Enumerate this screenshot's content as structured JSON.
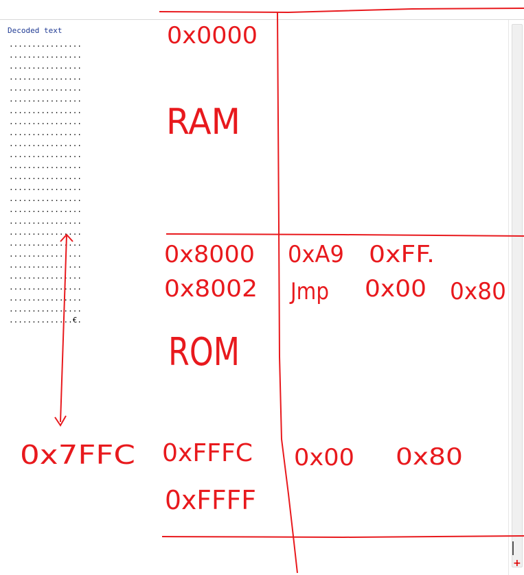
{
  "panel": {
    "title": "Decoded text",
    "lines": [
      "................",
      "................",
      "................",
      "................",
      "................",
      "................",
      "................",
      "................",
      "................",
      "................",
      "................",
      "................",
      "................",
      "................",
      "................",
      "................",
      "................",
      "................",
      "................",
      "................",
      "................",
      "................",
      "................",
      "................",
      "................",
      "..............€."
    ]
  },
  "annotations": {
    "ram_start": "0x0000",
    "ram_label": "RAM",
    "rom_start": "0x8000",
    "rom_next": "0x8002",
    "op_lda": "0xA9",
    "op_lda_arg": "0xFF.",
    "op_jmp": "Jmp",
    "op_jmp_lo": "0x00",
    "op_jmp_hi": "0x80",
    "rom_label": "ROM",
    "offset_label": "0x7FFC",
    "reset_vector": "0xFFFC",
    "rom_end": "0xFFFF",
    "vec_lo": "0x00",
    "vec_hi": "0x80"
  },
  "colors": {
    "ink": "#e8191d",
    "decoded_title": "#1f3a93"
  },
  "icons": {
    "scroll_corner": "plus-icon"
  }
}
